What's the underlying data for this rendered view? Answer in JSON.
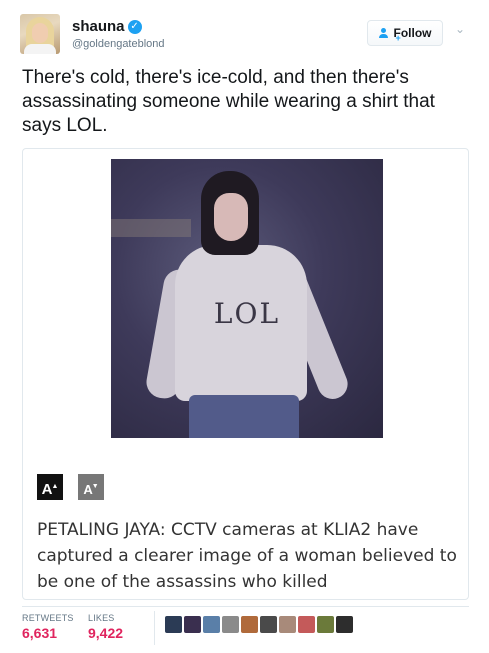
{
  "user": {
    "display_name": "shauna",
    "handle": "@goldengateblond",
    "verified_icon": "verified-badge-icon"
  },
  "actions": {
    "follow_label": "Follow",
    "caret_icon": "chevron-down-icon"
  },
  "tweet": {
    "text": "There's cold, there's ice-cold, and then there's assassinating someone while wearing a shirt that says LOL."
  },
  "card": {
    "photo_text": "LOL",
    "font_larger": "A",
    "font_smaller": "A",
    "article_text": "PETALING JAYA: CCTV cameras at KLIA2 have captured a clearer image of a woman believed to be one of the assassins who killed"
  },
  "stats": {
    "retweets_label": "RETWEETS",
    "retweets_value": "6,631",
    "likes_label": "LIKES",
    "likes_value": "9,422",
    "liker_colors": [
      "#2b3b55",
      "#3a2f4f",
      "#5a7fa8",
      "#8a8a8a",
      "#b06a3b",
      "#4a4a4a",
      "#a88a7a",
      "#c45a5a",
      "#6b7a3a",
      "#2d2d2d"
    ]
  },
  "colors": {
    "accent": "#1da1f2",
    "likes": "#e0245e"
  }
}
